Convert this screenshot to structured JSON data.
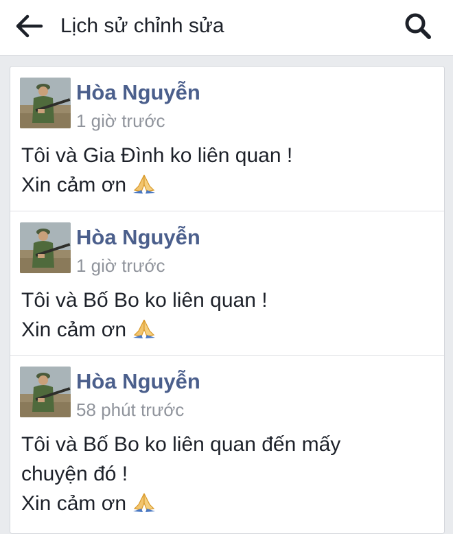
{
  "header": {
    "back_icon": "arrow-left-icon",
    "title": "Lịch sử chỉnh sửa",
    "search_icon": "search-icon"
  },
  "entries": [
    {
      "author": "Hòa Nguyễn",
      "time": "1 giờ trước",
      "lines": [
        "Tôi và Gia Đình ko liên quan !",
        "Xin cảm ơn"
      ],
      "emoji": "folded-hands-icon"
    },
    {
      "author": "Hòa Nguyễn",
      "time": "1 giờ trước",
      "lines": [
        "Tôi và Bố Bo ko liên quan !",
        "Xin cảm ơn"
      ],
      "emoji": "folded-hands-icon"
    },
    {
      "author": "Hòa Nguyễn",
      "time": "58 phút trước",
      "lines": [
        "Tôi và Bố Bo ko liên quan đến mấy",
        "chuyện đó !",
        "Xin cảm ơn"
      ],
      "emoji": "folded-hands-icon"
    }
  ],
  "colors": {
    "author_link": "#4b5f8c",
    "timestamp": "#90949c",
    "text": "#1d2129",
    "background": "#e9ebee"
  }
}
